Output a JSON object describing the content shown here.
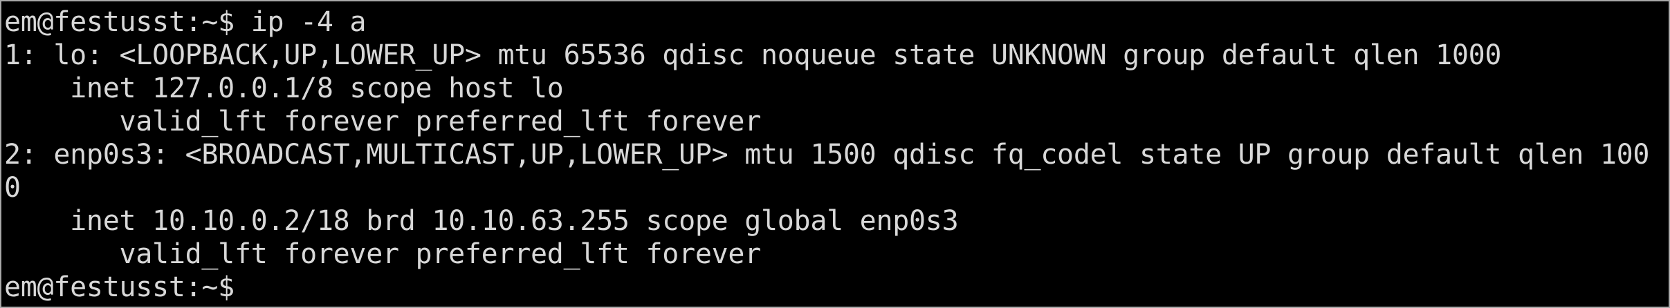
{
  "terminal": {
    "lines": [
      "em@festusst:~$ ip -4 a",
      "1: lo: <LOOPBACK,UP,LOWER_UP> mtu 65536 qdisc noqueue state UNKNOWN group default qlen 1000",
      "    inet 127.0.0.1/8 scope host lo",
      "       valid_lft forever preferred_lft forever",
      "2: enp0s3: <BROADCAST,MULTICAST,UP,LOWER_UP> mtu 1500 qdisc fq_codel state UP group default qlen 100",
      "0",
      "    inet 10.10.0.2/18 brd 10.10.63.255 scope global enp0s3",
      "       valid_lft forever preferred_lft forever",
      "em@festusst:~$ "
    ]
  }
}
